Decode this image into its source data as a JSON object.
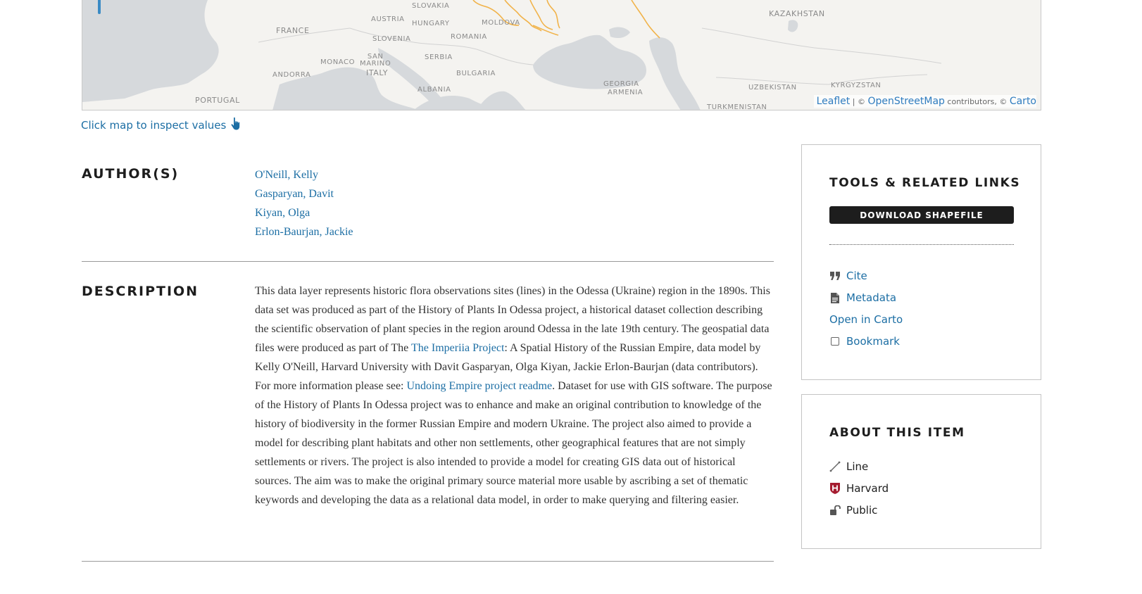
{
  "map": {
    "labels": {
      "slovakia": "SLOVAKIA",
      "austria": "AUSTRIA",
      "hungary": "HUNGARY",
      "moldova": "MOLDOVA",
      "france": "FRANCE",
      "slovenia": "SLOVENIA",
      "romania": "ROMANIA",
      "san_marino": "SAN\nMARINO",
      "monaco": "MONACO",
      "serbia": "SERBIA",
      "andorra": "ANDORRA",
      "italy": "ITALY",
      "bulgaria": "BULGARIA",
      "albania": "ALBANIA",
      "portugal": "PORTUGAL",
      "georgia": "GEORGIA",
      "armenia": "ARMENIA",
      "kazakhstan": "KAZAKHSTAN",
      "uzbekistan": "UZBEKISTAN",
      "kyrgyzstan": "KYRGYZSTAN",
      "turkmenistan": "TURKMENISTAN"
    },
    "attribution": {
      "leaflet": "Leaflet",
      "sep1": " | © ",
      "osm": "OpenStreetMap",
      "contributors": " contributors, © ",
      "carto": "Carto"
    },
    "colors": {
      "land": "#f4f3f0",
      "water": "#d6d9dc",
      "route": "#f1b34a"
    }
  },
  "inspect": {
    "label": "Click map to inspect values",
    "icon": "pointer-hand-icon"
  },
  "authors": {
    "heading": "AUTHOR(S)",
    "names": [
      "O'Neill, Kelly",
      "Gasparyan, Davit",
      "Kiyan, Olga",
      "Erlon-Baurjan, Jackie"
    ]
  },
  "description": {
    "heading": "DESCRIPTION",
    "text_1": "This data layer represents historic flora observations sites (lines) in the Odessa (Ukraine) region in the 1890s. This data set was produced as part of the History of Plants In Odessa project, a historical dataset collection describing the scientific observation of plant species in the region around Odessa in the late 19th century. The geospatial data files were produced as part of The ",
    "link_1": "The Imperiia Project",
    "text_2": ": A Spatial History of the Russian Empire, data model by Kelly O'Neill, Harvard University with Davit Gasparyan, Olga Kiyan, Jackie Erlon-Baurjan (data contributors). For more information please see: ",
    "link_2": "Undoing Empire project readme",
    "text_3": ". Dataset for use with GIS software. The purpose of the History of Plants In Odessa project was to enhance and make an original contribution to knowledge of the history of biodiversity in the former Russian Empire and modern Ukraine. The project also aimed to provide a model for describing plant habitats and other non settlements, other geographical features that are not simply settlements or rivers. The project is also intended to provide a model for creating GIS data out of historical sources. The aim was to make the original primary source material more usable by ascribing a set of thematic keywords and developing the data as a relational data model, in order to make querying and filtering easier."
  },
  "tools": {
    "title": "TOOLS & RELATED LINKS",
    "download_label": "DOWNLOAD SHAPEFILE",
    "cite": "Cite",
    "metadata": "Metadata",
    "open_carto": "Open in Carto",
    "bookmark": "Bookmark"
  },
  "about": {
    "title": "ABOUT THIS ITEM",
    "geometry": "Line",
    "institution": "Harvard",
    "access": "Public"
  }
}
